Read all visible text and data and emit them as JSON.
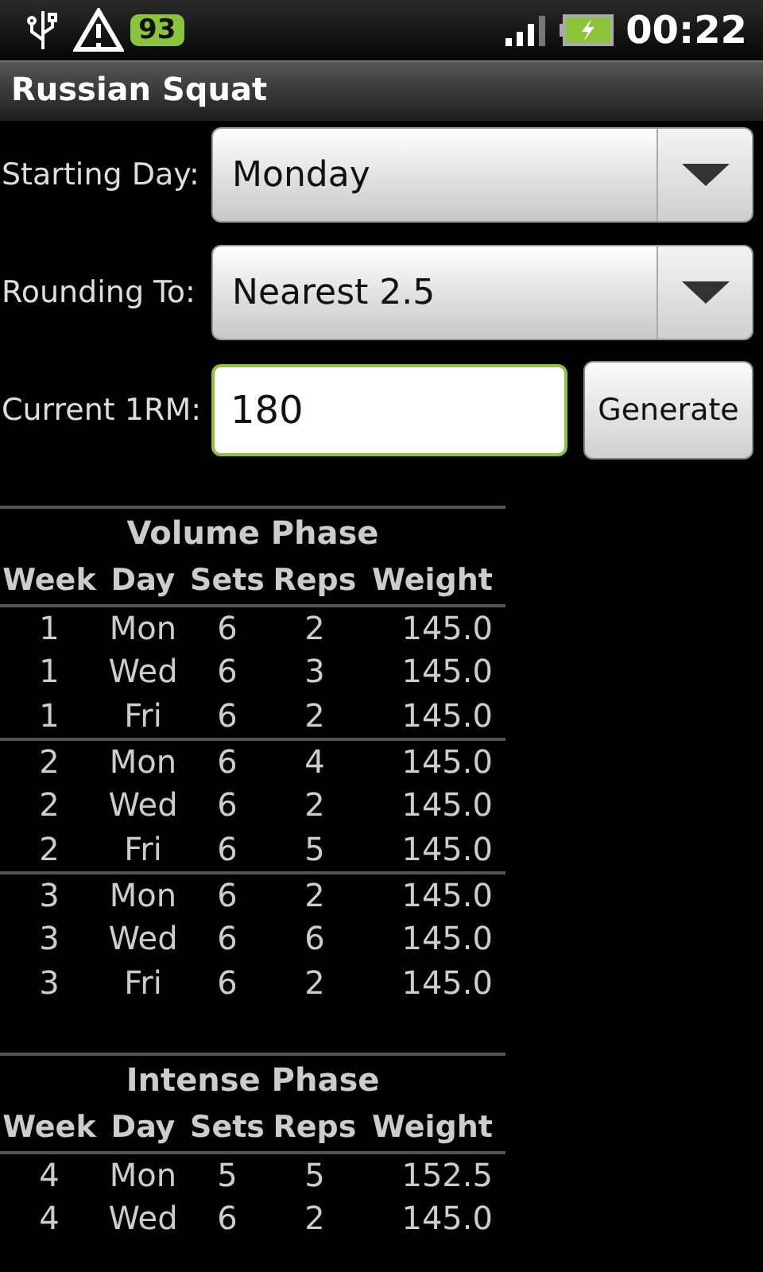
{
  "status_bar": {
    "badge": "93",
    "time": "00:22"
  },
  "title": "Russian Squat",
  "form": [
    {
      "kind": "spinner",
      "label": "Starting Day:",
      "value": "Monday"
    },
    {
      "kind": "spinner",
      "label": "Rounding To:",
      "value": "Nearest 2.5"
    },
    {
      "kind": "input",
      "label": "Current 1RM:",
      "value": "180",
      "button": "Generate"
    }
  ],
  "phases": [
    {
      "title": "Volume Phase",
      "columns": [
        "Week",
        "Day",
        "Sets",
        "Reps",
        "Weight"
      ],
      "weeks": [
        {
          "rows": [
            [
              "1",
              "Mon",
              "6",
              "2",
              "145.0"
            ],
            [
              "1",
              "Wed",
              "6",
              "3",
              "145.0"
            ],
            [
              "1",
              "Fri",
              "6",
              "2",
              "145.0"
            ]
          ]
        },
        {
          "rows": [
            [
              "2",
              "Mon",
              "6",
              "4",
              "145.0"
            ],
            [
              "2",
              "Wed",
              "6",
              "2",
              "145.0"
            ],
            [
              "2",
              "Fri",
              "6",
              "5",
              "145.0"
            ]
          ]
        },
        {
          "rows": [
            [
              "3",
              "Mon",
              "6",
              "2",
              "145.0"
            ],
            [
              "3",
              "Wed",
              "6",
              "6",
              "145.0"
            ],
            [
              "3",
              "Fri",
              "6",
              "2",
              "145.0"
            ]
          ]
        }
      ]
    },
    {
      "title": "Intense Phase",
      "columns": [
        "Week",
        "Day",
        "Sets",
        "Reps",
        "Weight"
      ],
      "weeks": [
        {
          "rows": [
            [
              "4",
              "Mon",
              "5",
              "5",
              "152.5"
            ],
            [
              "4",
              "Wed",
              "6",
              "2",
              "145.0"
            ]
          ]
        }
      ]
    }
  ]
}
